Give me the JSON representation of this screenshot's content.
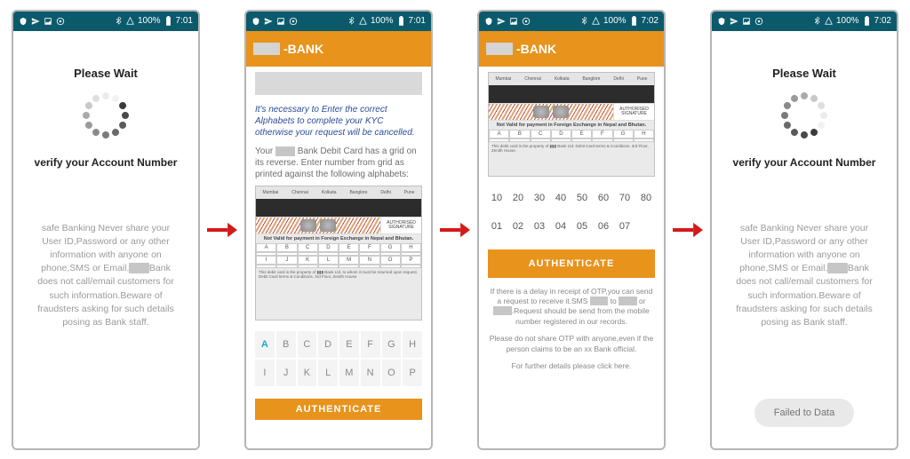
{
  "statusbar": {
    "battery": "100%",
    "time1": "7:01",
    "time2": "7:02"
  },
  "screen1": {
    "please_wait": "Please Wait",
    "verify": "verify your Account Number",
    "safe_pre": "safe  Banking Never share your User ID,Password or any other information with anyone on phone,SMS or Email.",
    "safe_post": "Bank does not call/email customers for such information.Beware of fraudsters asking for such details posing as Bank staff."
  },
  "screen2": {
    "bank_suffix": "-BANK",
    "kyc_warning": "It's necessary to Enter the correct Alphabets to complete your KYC otherwise your request will be cancelled.",
    "grid_instr_pre": "Your",
    "grid_instr_post": "Bank Debit Card has a grid on its reverse. Enter number from grid as printed against the following alphabets:",
    "authenticate": "AUTHENTICATE"
  },
  "cardback": {
    "auth_sig": "AUTHORISED SIGNATURE",
    "notvalid": "Not Valid for payment in  Foreign Exchange in Nepal and Bhutan.",
    "grid_letters": [
      "A",
      "B",
      "C",
      "D",
      "E",
      "F",
      "G",
      "H",
      "I",
      "J",
      "K",
      "L",
      "M",
      "N",
      "O",
      "P"
    ]
  },
  "alpha": {
    "row": [
      "A",
      "B",
      "C",
      "D",
      "E",
      "F",
      "G",
      "H",
      "I",
      "J",
      "K",
      "L",
      "M",
      "N",
      "O",
      "P"
    ]
  },
  "screen3": {
    "bank_suffix": "-BANK",
    "numbers_row1": [
      "10",
      "20",
      "30",
      "40",
      "50",
      "60",
      "70",
      "80"
    ],
    "numbers_row2": [
      "01",
      "02",
      "03",
      "04",
      "05",
      "06",
      "07"
    ],
    "authenticate": "AUTHENTICATE",
    "otp1_pre": "If there is a delay in receipt of OTP,you can send a request to receive it.SMS",
    "otp1_mid": "to",
    "otp1_mid2": "or",
    "otp1_post": ".Request should be send from the mobile number registered in our records.",
    "otp2_pre": "Please do not share OTP with anyone,even if the person claims to be an",
    "otp2_post": "Bank official.",
    "otp3": "For further details please click here."
  },
  "screen4": {
    "please_wait": "Please Wait",
    "verify": "verify your Account Number",
    "safe_pre": "safe  Banking Never share your User ID,Password or any other information with anyone on phone,SMS or Email.",
    "safe_post": "Bank does not call/email customers for such information.Beware of fraudsters asking for such details posing as Bank staff.",
    "failed": "Failed to Data"
  }
}
